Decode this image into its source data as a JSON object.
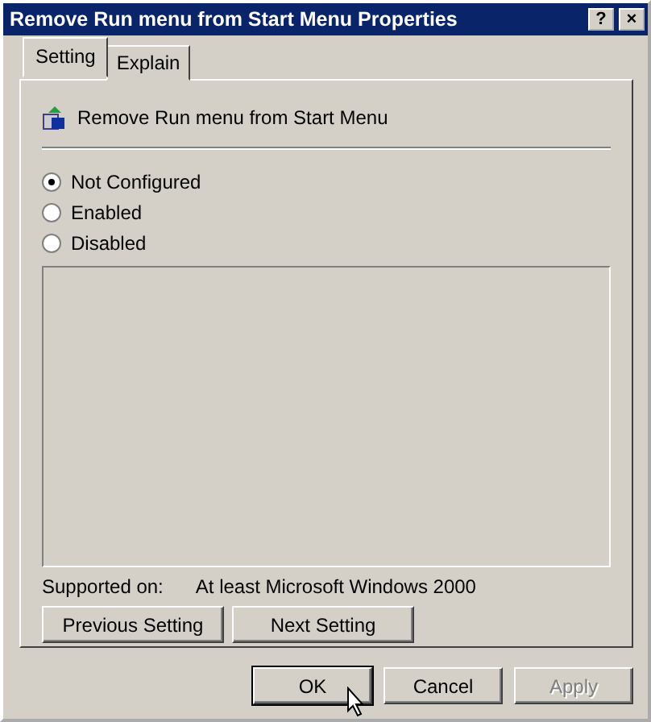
{
  "window": {
    "title": "Remove Run menu from Start Menu Properties",
    "title_buttons": [
      "?",
      "×"
    ]
  },
  "tabs": [
    {
      "label": "Setting",
      "selected": true
    },
    {
      "label": "Explain",
      "selected": false
    }
  ],
  "policy": {
    "name": "Remove Run menu from Start Menu"
  },
  "options": [
    {
      "label": "Not Configured",
      "selected": true
    },
    {
      "label": "Enabled",
      "selected": false
    },
    {
      "label": "Disabled",
      "selected": false
    }
  ],
  "supported_on": {
    "label": "Supported on:",
    "value": "At least Microsoft Windows 2000"
  },
  "nav_buttons": [
    "Previous Setting",
    "Next Setting"
  ],
  "buttons": [
    {
      "label": "OK",
      "default": true,
      "disabled": false
    },
    {
      "label": "Cancel",
      "default": false,
      "disabled": false
    },
    {
      "label": "Apply",
      "default": false,
      "disabled": true
    }
  ]
}
